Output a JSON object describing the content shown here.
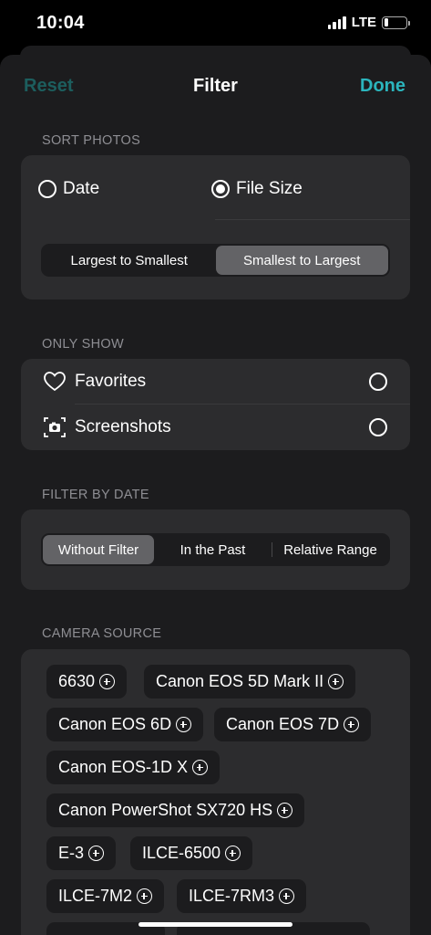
{
  "status": {
    "time": "10:04",
    "network": "LTE",
    "battery_level": 0.2
  },
  "nav": {
    "reset": "Reset",
    "title": "Filter",
    "done": "Done"
  },
  "sort": {
    "header": "SORT PHOTOS",
    "options": [
      {
        "label": "Date",
        "selected": false
      },
      {
        "label": "File Size",
        "selected": true
      }
    ],
    "order": {
      "left": "Largest to Smallest",
      "right": "Smallest to Largest",
      "selected": "Smallest to Largest"
    }
  },
  "only_show": {
    "header": "ONLY SHOW",
    "items": [
      {
        "label": "Favorites",
        "icon": "heart-icon",
        "selected": false
      },
      {
        "label": "Screenshots",
        "icon": "screenshot-icon",
        "selected": false
      }
    ]
  },
  "date_filter": {
    "header": "FILTER BY DATE",
    "options": [
      "Without Filter",
      "In the Past",
      "Relative Range"
    ],
    "selected": "Without Filter"
  },
  "camera": {
    "header": "CAMERA SOURCE",
    "sources": [
      "6630",
      "Canon EOS 5D Mark II",
      "Canon EOS 6D",
      "Canon EOS 7D",
      "Canon EOS-1D X",
      "Canon PowerShot SX720 HS",
      "E-3",
      "ILCE-6500",
      "ILCE-7M2",
      "ILCE-7RM3"
    ]
  },
  "colors": {
    "accent": "#2bb5bd",
    "reset": "#1c5e5e",
    "sheet": "#1c1c1e",
    "card": "#2c2c2e"
  }
}
